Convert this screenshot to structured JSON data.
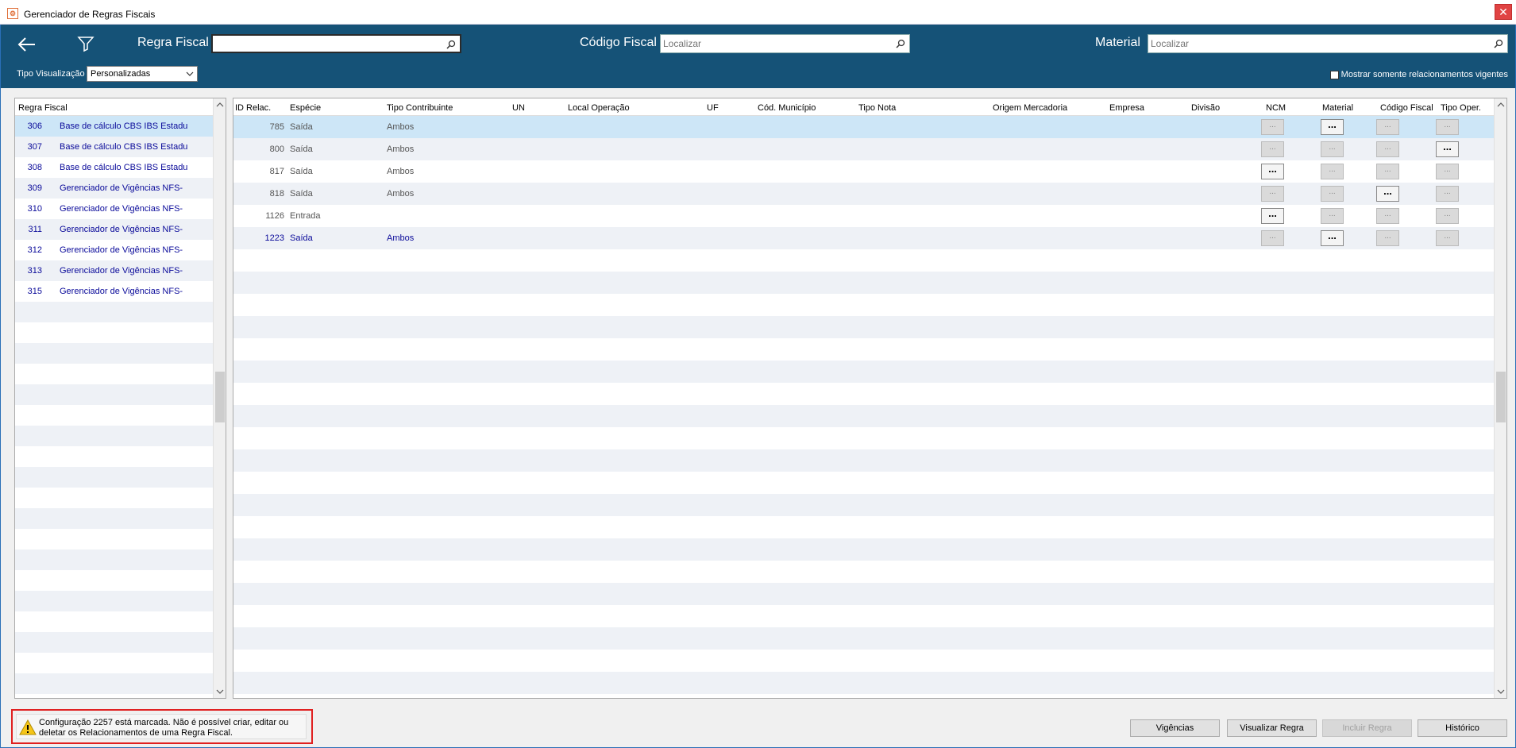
{
  "window": {
    "title": "Gerenciador de Regras Fiscais",
    "icon": "app-icon",
    "close_symbol": "✕"
  },
  "header": {
    "regra_label": "Regra Fiscal",
    "regra_value": "",
    "codigo_label": "Código Fiscal",
    "codigo_placeholder": "Localizar",
    "material_label": "Material",
    "material_placeholder": "Localizar",
    "tipo_visualizacao_label": "Tipo Visualização",
    "tipo_visualizacao_value": "Personalizadas",
    "mostrar_label": "Mostrar somente relacionamentos vigentes",
    "mostrar_checked": false,
    "bg_color": "#155277"
  },
  "left_panel": {
    "header": "Regra Fiscal",
    "rows": [
      {
        "id": "306",
        "name": "Base de cálculo CBS IBS Estadu"
      },
      {
        "id": "307",
        "name": "Base de cálculo CBS IBS Estadu"
      },
      {
        "id": "308",
        "name": "Base de cálculo CBS IBS Estadu"
      },
      {
        "id": "309",
        "name": "Gerenciador de Vigências  NFS-"
      },
      {
        "id": "310",
        "name": "Gerenciador de Vigências  NFS-"
      },
      {
        "id": "311",
        "name": "Gerenciador de Vigências  NFS-"
      },
      {
        "id": "312",
        "name": "Gerenciador de Vigências  NFS-"
      },
      {
        "id": "313",
        "name": "Gerenciador de Vigências  NFS-"
      },
      {
        "id": "315",
        "name": "Gerenciador de Vigências  NFS-"
      }
    ],
    "selected_index": 0
  },
  "right_panel": {
    "columns": [
      "ID Relac.",
      "Espécie",
      "Tipo Contribuinte",
      "UN",
      "Local Operação",
      "UF",
      "Cód. Município",
      "Tipo Nota",
      "Origem Mercadoria",
      "Empresa",
      "Divisão",
      "NCM",
      "Material",
      "Código Fiscal",
      "Tipo Oper."
    ],
    "rows": [
      {
        "id": "785",
        "especie": "Saída",
        "tipo_contribuinte": "Ambos",
        "ncm": false,
        "material": true,
        "codigo_fiscal": false,
        "tipo_oper": false,
        "selected": true,
        "active": false
      },
      {
        "id": "800",
        "especie": "Saída",
        "tipo_contribuinte": "Ambos",
        "ncm": false,
        "material": false,
        "codigo_fiscal": false,
        "tipo_oper": true,
        "selected": false,
        "active": false
      },
      {
        "id": "817",
        "especie": "Saída",
        "tipo_contribuinte": "Ambos",
        "ncm": true,
        "material": false,
        "codigo_fiscal": false,
        "tipo_oper": false,
        "selected": false,
        "active": false
      },
      {
        "id": "818",
        "especie": "Saída",
        "tipo_contribuinte": "Ambos",
        "ncm": false,
        "material": false,
        "codigo_fiscal": true,
        "tipo_oper": false,
        "selected": false,
        "active": false
      },
      {
        "id": "1126",
        "especie": "Entrada",
        "tipo_contribuinte": "",
        "ncm": true,
        "material": false,
        "codigo_fiscal": false,
        "tipo_oper": false,
        "selected": false,
        "active": false
      },
      {
        "id": "1223",
        "especie": "Saída",
        "tipo_contribuinte": "Ambos",
        "ncm": false,
        "material": true,
        "codigo_fiscal": false,
        "tipo_oper": false,
        "selected": false,
        "active": true
      }
    ],
    "ellipsis_label": "..."
  },
  "footer": {
    "message": "Configuração 2257 está marcada. Não é possível criar, editar ou deletar os Relacionamentos de uma Regra Fiscal.",
    "buttons": {
      "vigencias": "Vigências",
      "visualizar": "Visualizar Regra",
      "incluir": "Incluir Regra",
      "historico": "Histórico"
    }
  }
}
